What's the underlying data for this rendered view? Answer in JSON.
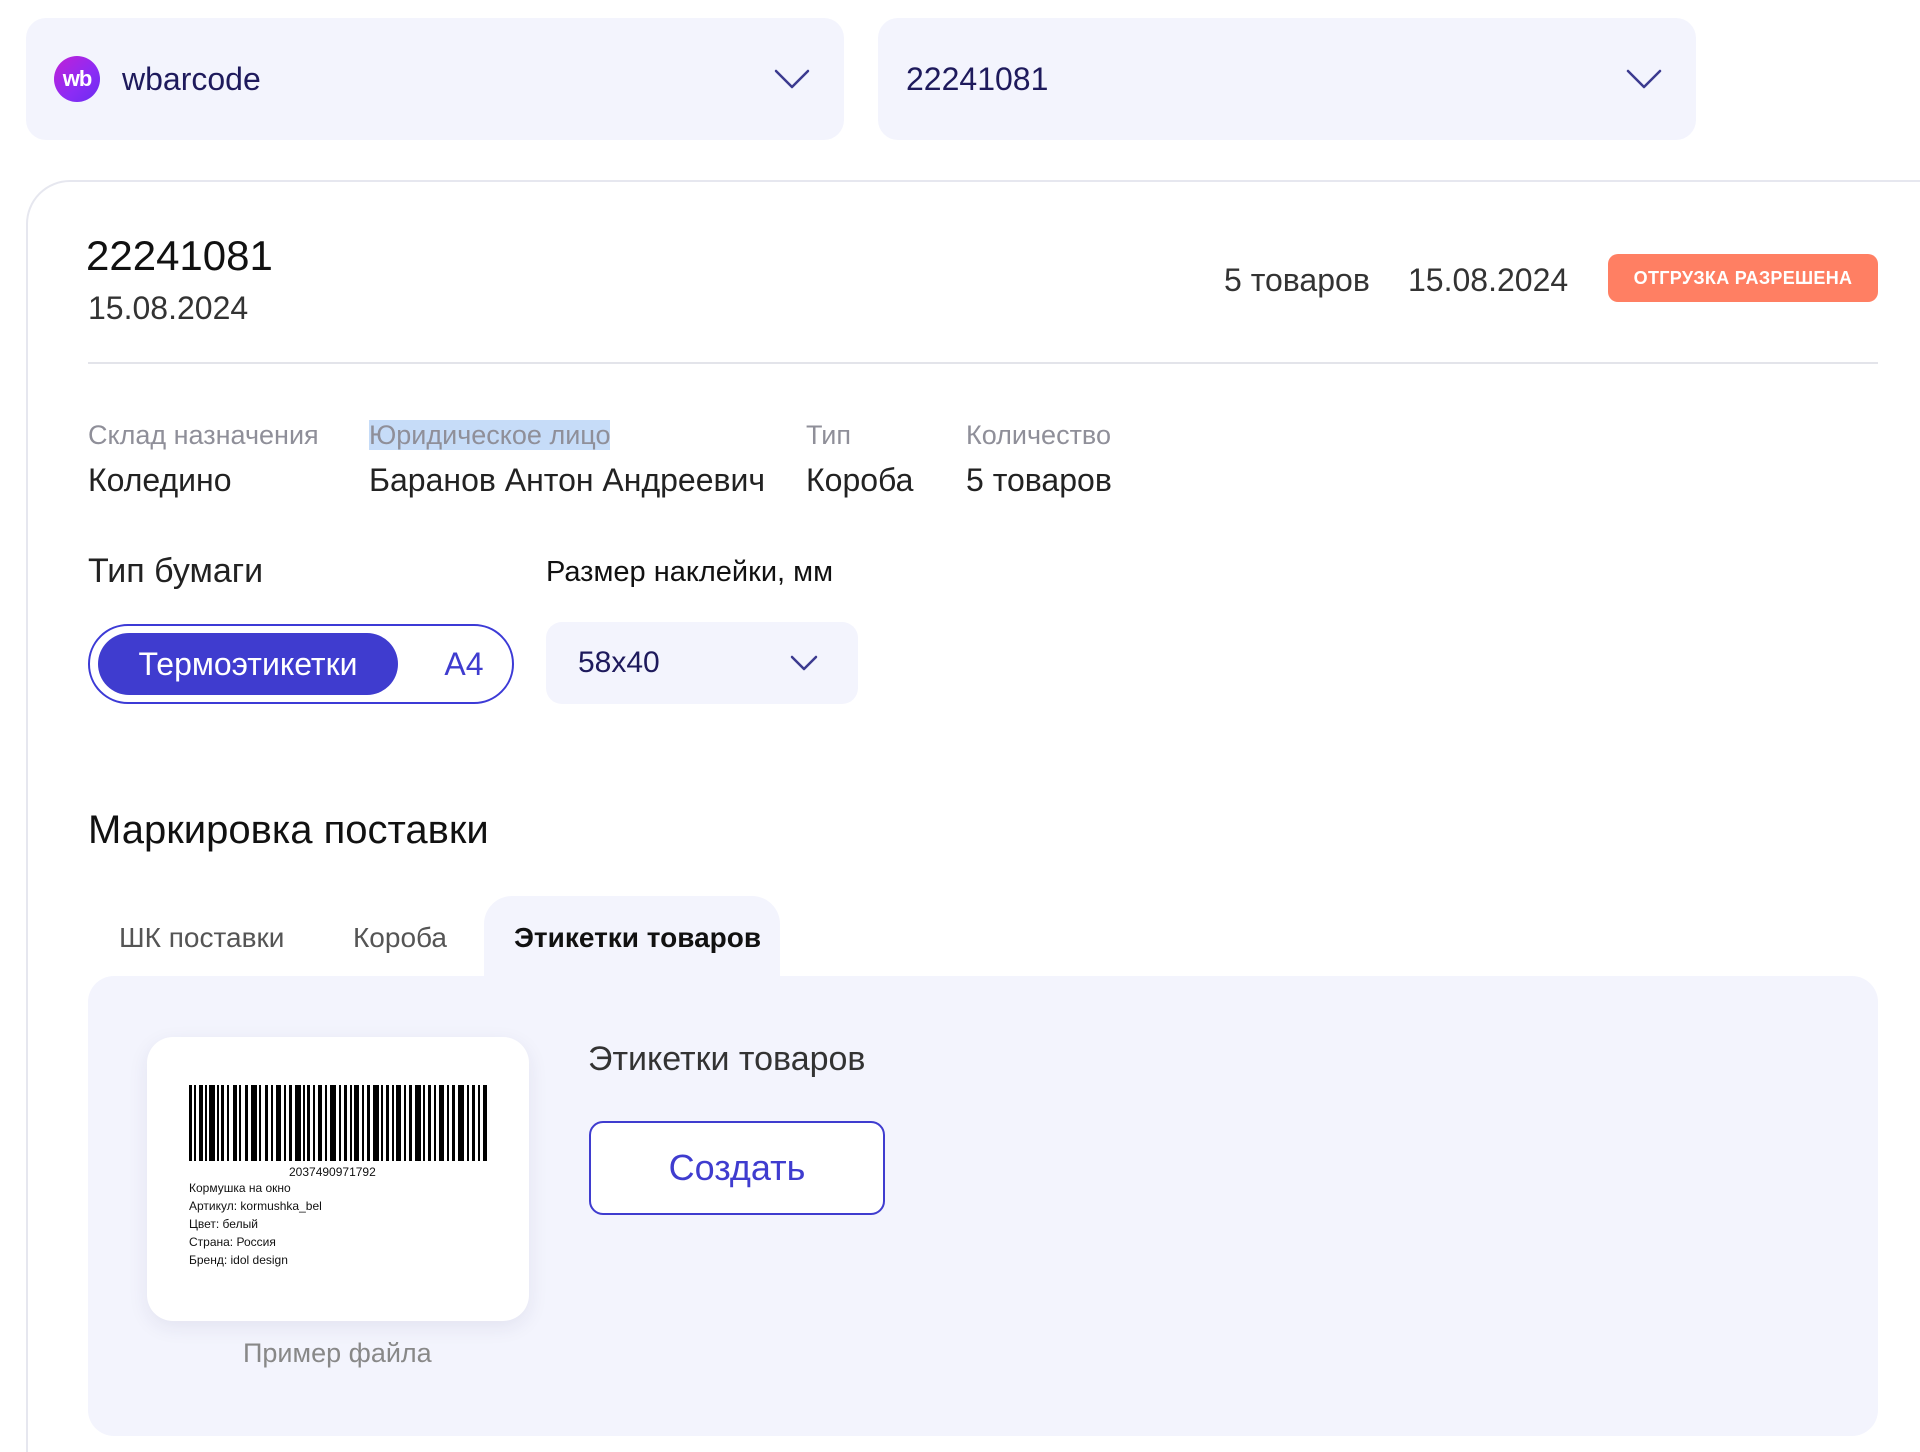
{
  "selectors": {
    "account": {
      "logo_text": "wb",
      "label": "wbarcode"
    },
    "supply": {
      "label": "22241081"
    }
  },
  "supply": {
    "id": "22241081",
    "date": "15.08.2024",
    "count": "5 товаров",
    "date_right": "15.08.2024",
    "status": "ОТГРУЗКА РАЗРЕШЕНА",
    "status_color": "#ff7f63"
  },
  "info": [
    {
      "label": "Склад назначения",
      "value": "Коледино"
    },
    {
      "label": "Юридическое лицо",
      "value": "Баранов Антон Андреевич"
    },
    {
      "label": "Тип",
      "value": "Короба"
    },
    {
      "label": "Количество",
      "value": "5 товаров"
    }
  ],
  "paper": {
    "label": "Тип бумаги",
    "options": [
      "Термоэтикетки",
      "А4"
    ],
    "selected": "Термоэтикетки"
  },
  "sticker_size": {
    "label": "Размер наклейки, мм",
    "value": "58x40"
  },
  "marking": {
    "title": "Маркировка поставки",
    "tabs": [
      "ШК поставки",
      "Короба",
      "Этикетки товаров"
    ],
    "active_tab": "Этикетки товаров"
  },
  "panel": {
    "title": "Этикетки товаров",
    "create_label": "Создать",
    "sample_caption": "Пример файла",
    "sample": {
      "barcode_number": "2037490971792",
      "lines": [
        "Кормушка на окно",
        "Артикул: kormushka_bel",
        "Цвет: белый",
        "Страна: Россия",
        "Бренд: idol design"
      ]
    }
  },
  "colors": {
    "accent": "#3f3ccf",
    "selector_bg": "#f3f4fd"
  }
}
